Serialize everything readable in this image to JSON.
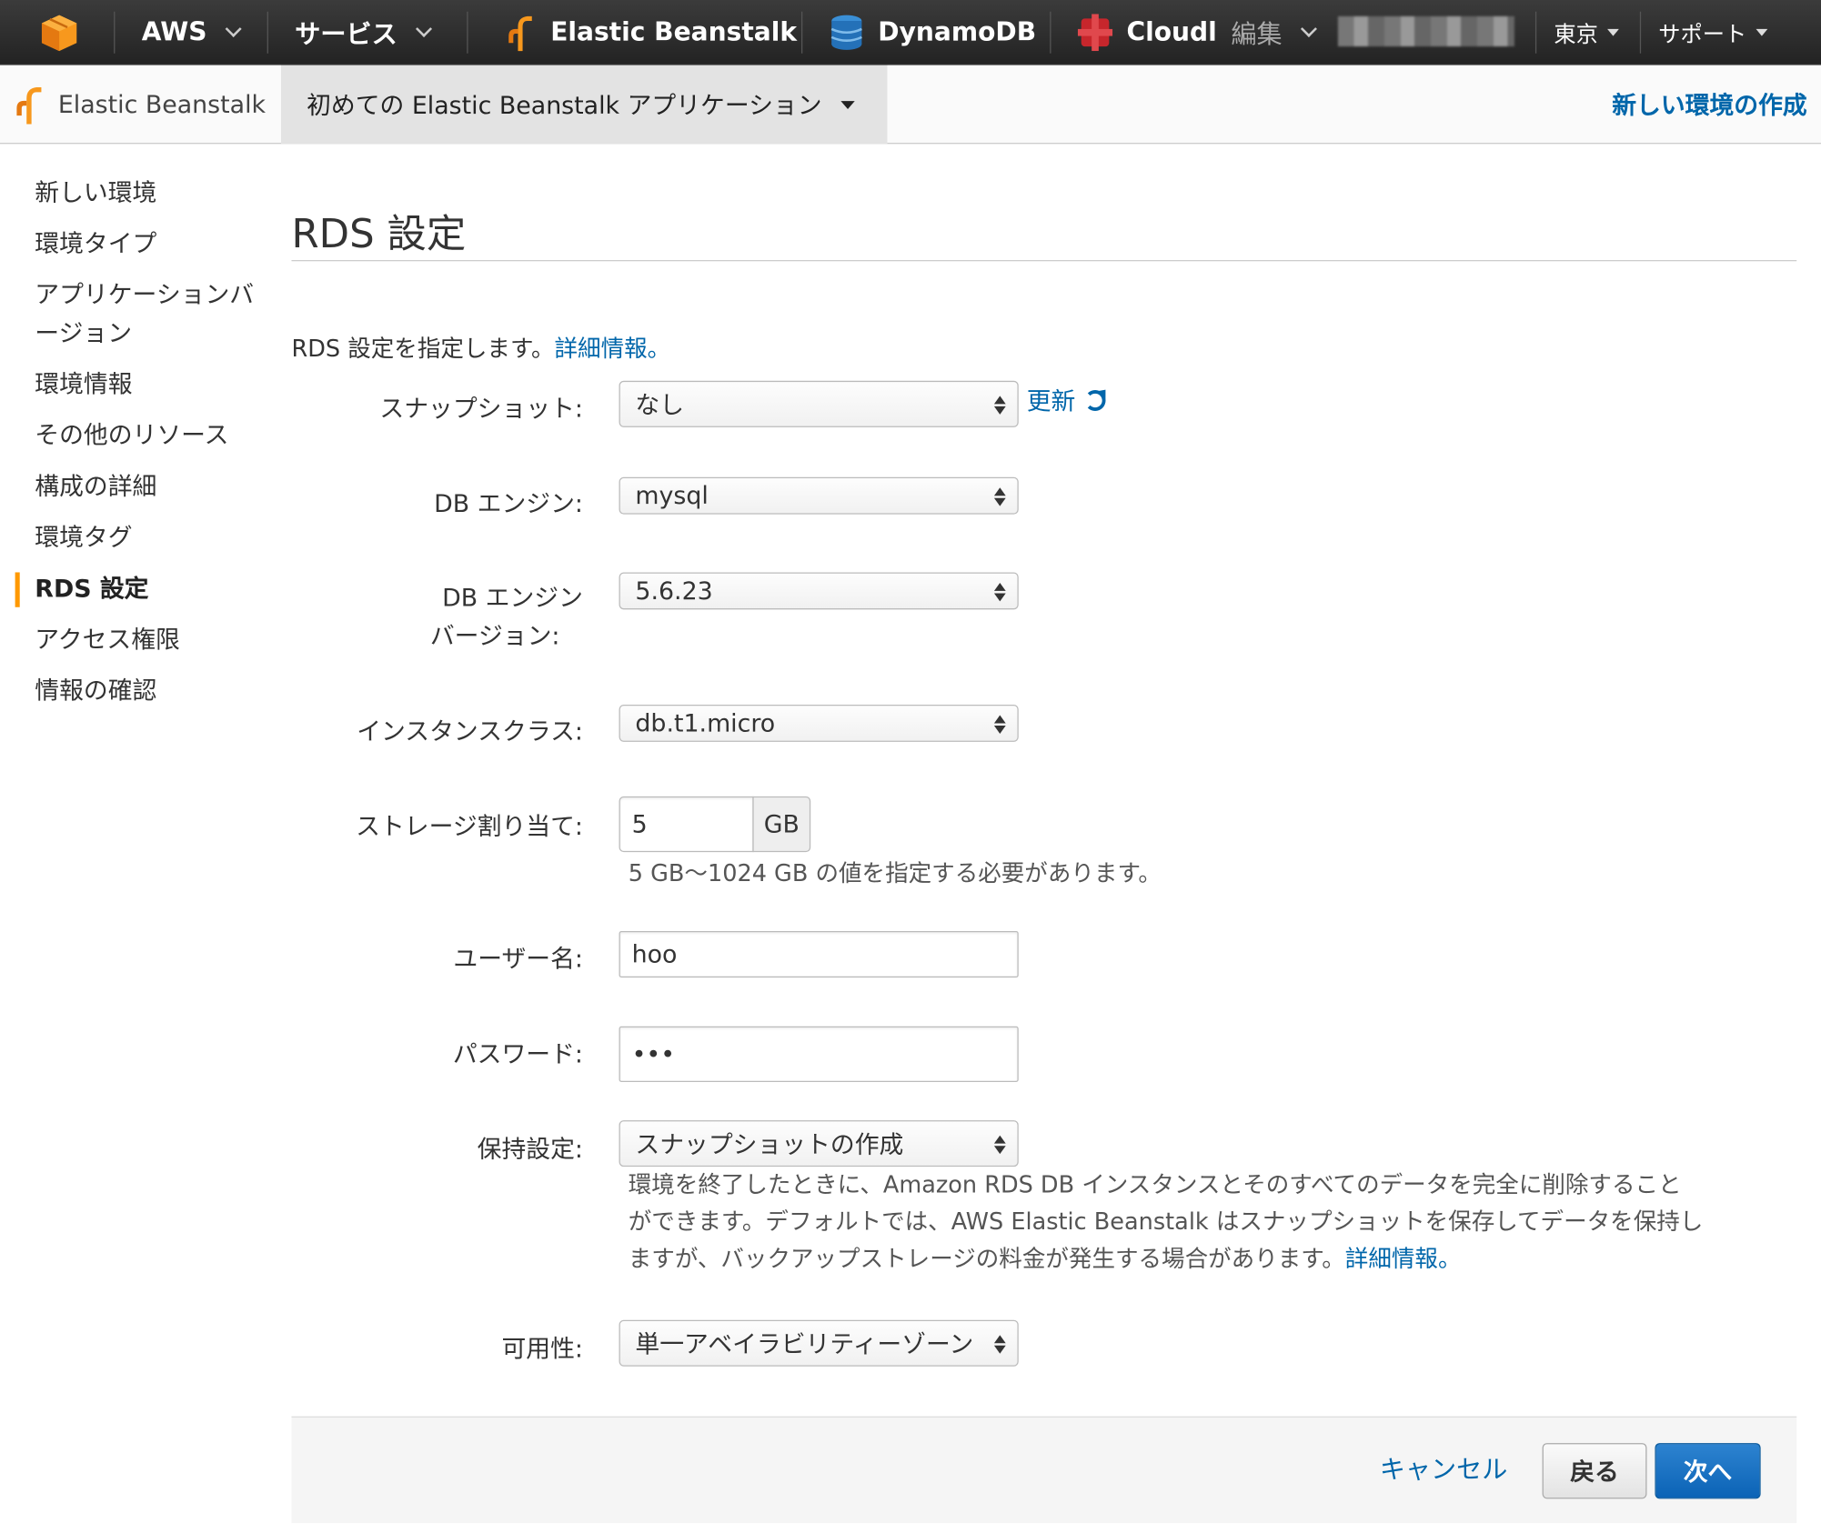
{
  "topnav": {
    "aws_label": "AWS",
    "services_label": "サービス",
    "beanstalk_label": "Elastic Beanstalk",
    "dynamodb_label": "DynamoDB",
    "cloud_label": "Cloudl",
    "edit_label": "編集",
    "region_label": "東京",
    "support_label": "サポート",
    "icons": [
      "aws-cube-icon",
      "beanstalk-icon",
      "dynamodb-icon",
      "cloudfront-icon"
    ],
    "colors": {
      "bar": "#2b2b2b",
      "orange": "#f90"
    }
  },
  "subnav": {
    "brand_label": "Elastic Beanstalk",
    "app_label": "初めての Elastic Beanstalk アプリケーション",
    "create_label": "新しい環境の作成"
  },
  "sidebar": {
    "items": [
      {
        "label": "新しい環境"
      },
      {
        "label": "環境タイプ"
      },
      {
        "label": "アプリケーションバ\nージョン"
      },
      {
        "label": "環境情報"
      },
      {
        "label": "その他のリソース"
      },
      {
        "label": "構成の詳細"
      },
      {
        "label": "環境タグ"
      },
      {
        "label": "RDS 設定"
      },
      {
        "label": "アクセス権限"
      },
      {
        "label": "情報の確認"
      }
    ],
    "active_index": 7
  },
  "main": {
    "title": "RDS 設定",
    "intro_text": "RDS 設定を指定します。",
    "intro_link": "詳細情報。",
    "refresh_label": "更新",
    "fields": {
      "snapshot": {
        "label": "スナップショット:",
        "value": "なし"
      },
      "engine": {
        "label": "DB エンジン:",
        "value": "mysql"
      },
      "engine_version": {
        "label_line1": "DB エンジン",
        "label_line2": "バージョン:",
        "value": "5.6.23"
      },
      "instance_class": {
        "label": "インスタンスクラス:",
        "value": "db.t1.micro"
      },
      "storage": {
        "label": "ストレージ割り当て:",
        "value": "5",
        "unit": "GB",
        "help": "5 GB〜1024 GB の値を指定する必要があります。"
      },
      "username": {
        "label": "ユーザー名:",
        "value": "hoo"
      },
      "password": {
        "label": "パスワード:",
        "value": "•••"
      },
      "retention": {
        "label": "保持設定:",
        "value": "スナップショットの作成",
        "help_line1": "環境を終了したときに、Amazon RDS DB インスタンスとそのすべてのデータを完全に削除すること",
        "help_line2": "ができます。デフォルトでは、AWS Elastic Beanstalk はスナップショットを保存してデータを保持し",
        "help_line3": "ますが、バックアップストレージの料金が発生する場合があります。",
        "help_link": "詳細情報。"
      },
      "availability": {
        "label": "可用性:",
        "value": "単一アベイラビリティーゾーン"
      }
    }
  },
  "footer": {
    "cancel_label": "キャンセル",
    "back_label": "戻る",
    "next_label": "次へ"
  }
}
